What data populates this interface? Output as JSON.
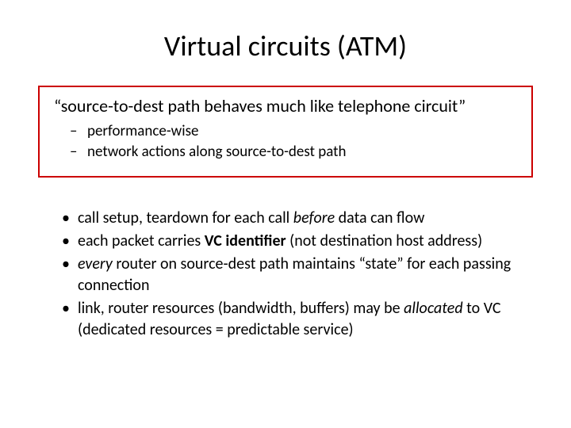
{
  "title": "Virtual circuits (ATM)",
  "box": {
    "quote": "“source-to-dest path behaves much like telephone circuit”",
    "sub": [
      "performance-wise",
      "network actions along source-to-dest path"
    ]
  },
  "bullets": {
    "b1a": "call setup, teardown for each call ",
    "b1b": "before",
    "b1c": " data can flow",
    "b2a": "each packet carries ",
    "b2b": "VC identifier",
    "b2c": " (not destination host address)",
    "b3a": "every",
    "b3b": " router on source-dest path maintains “state” for each passing connection",
    "b4a": "link, router resources (bandwidth, buffers) may be ",
    "b4b": "allocated",
    "b4c": " to VC (dedicated resources = predictable service)"
  }
}
